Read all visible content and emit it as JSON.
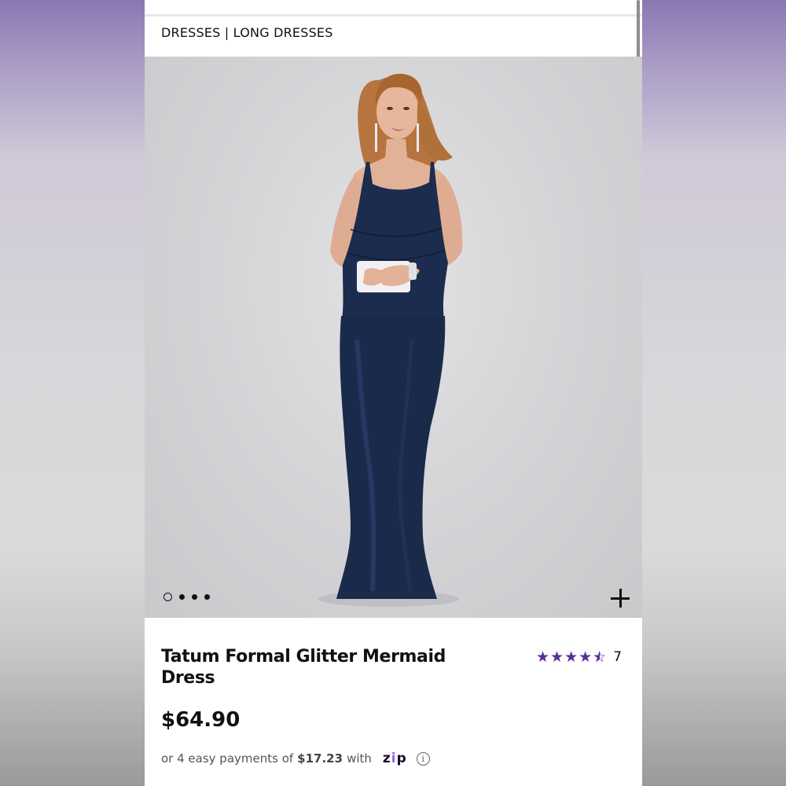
{
  "breadcrumb": "DRESSES | LONG DRESSES",
  "product": {
    "title": "Tatum Formal Glitter Mermaid Dress",
    "image": "product-photo-model-navy-dress",
    "rating_value": 4.5,
    "rating_max": 5,
    "rating_count": "7",
    "price": "$64.90"
  },
  "carousel": {
    "total": 4,
    "active_index": 0
  },
  "payment": {
    "prefix": "or 4 easy payments of",
    "amount": "$17.23",
    "with": "with",
    "provider": "zip"
  },
  "icons": {
    "zoom": "plus-icon",
    "info": "info-icon",
    "star": "star-icon"
  },
  "colors": {
    "star": "#5b2d9a",
    "zip_brand": "#9d5ce6",
    "dress": "#1c2c4e"
  }
}
